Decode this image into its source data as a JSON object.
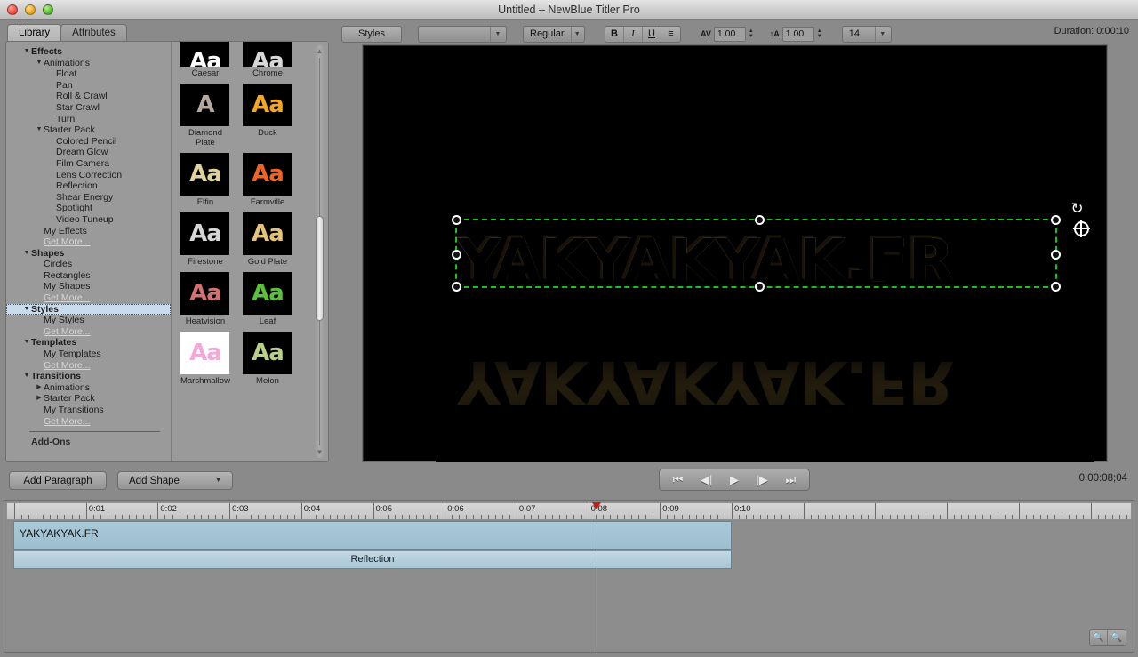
{
  "window": {
    "title": "Untitled – NewBlue Titler Pro",
    "traffic_lights": [
      "close-button",
      "minimize-button",
      "zoom-button"
    ]
  },
  "tabs": [
    {
      "label": "Library",
      "active": true
    },
    {
      "label": "Attributes",
      "active": false
    }
  ],
  "tree": [
    {
      "label": "Effects",
      "level": 0,
      "arrow": "▼"
    },
    {
      "label": "Animations",
      "level": 1,
      "arrow": "▼"
    },
    {
      "label": "Float",
      "level": 2,
      "arrow": ""
    },
    {
      "label": "Pan",
      "level": 2,
      "arrow": ""
    },
    {
      "label": "Roll & Crawl",
      "level": 2,
      "arrow": ""
    },
    {
      "label": "Star Crawl",
      "level": 2,
      "arrow": ""
    },
    {
      "label": "Turn",
      "level": 2,
      "arrow": ""
    },
    {
      "label": "Starter Pack",
      "level": 1,
      "arrow": "▼"
    },
    {
      "label": "Colored Pencil",
      "level": 2,
      "arrow": ""
    },
    {
      "label": "Dream Glow",
      "level": 2,
      "arrow": ""
    },
    {
      "label": "Film Camera",
      "level": 2,
      "arrow": ""
    },
    {
      "label": "Lens Correction",
      "level": 2,
      "arrow": ""
    },
    {
      "label": "Reflection",
      "level": 2,
      "arrow": ""
    },
    {
      "label": "Shear Energy",
      "level": 2,
      "arrow": ""
    },
    {
      "label": "Spotlight",
      "level": 2,
      "arrow": ""
    },
    {
      "label": "Video Tuneup",
      "level": 2,
      "arrow": ""
    },
    {
      "label": "My Effects",
      "level": 1,
      "arrow": ""
    },
    {
      "label": "Get More...",
      "level": 1,
      "arrow": "",
      "link": true
    },
    {
      "label": "Shapes",
      "level": 0,
      "arrow": "▼"
    },
    {
      "label": "Circles",
      "level": 1,
      "arrow": ""
    },
    {
      "label": "Rectangles",
      "level": 1,
      "arrow": ""
    },
    {
      "label": "My Shapes",
      "level": 1,
      "arrow": ""
    },
    {
      "label": "Get More...",
      "level": 1,
      "arrow": "",
      "link": true
    },
    {
      "label": "Styles",
      "level": 0,
      "arrow": "▼",
      "selected": true
    },
    {
      "label": "My Styles",
      "level": 1,
      "arrow": ""
    },
    {
      "label": "Get More...",
      "level": 1,
      "arrow": "",
      "link": true
    },
    {
      "label": "Templates",
      "level": 0,
      "arrow": "▼"
    },
    {
      "label": "My Templates",
      "level": 1,
      "arrow": ""
    },
    {
      "label": "Get More...",
      "level": 1,
      "arrow": "",
      "link": true
    },
    {
      "label": "Transitions",
      "level": 0,
      "arrow": "▼"
    },
    {
      "label": "Animations",
      "level": 1,
      "arrow": "▶"
    },
    {
      "label": "Starter Pack",
      "level": 1,
      "arrow": "▶"
    },
    {
      "label": "My Transitions",
      "level": 1,
      "arrow": ""
    },
    {
      "label": "Get More...",
      "level": 1,
      "arrow": "",
      "link": true
    }
  ],
  "tree_footer": {
    "label": "Add-Ons"
  },
  "style_thumbnails": [
    {
      "name": "Caesar",
      "glyph": "Aa",
      "fg": "#ffffff",
      "bg": "#000000",
      "partial": true
    },
    {
      "name": "Chrome",
      "glyph": "Aa",
      "fg": "#d8d8d8",
      "bg": "#000000",
      "partial": true
    },
    {
      "name": "Diamond Plate",
      "glyph": "A",
      "fg": "#b6a89c",
      "bg": "#000000"
    },
    {
      "name": "Duck",
      "glyph": "Aa",
      "fg": "#f5a623",
      "bg": "#000000"
    },
    {
      "name": "Elfin",
      "glyph": "Aa",
      "fg": "#ded39a",
      "bg": "#000000"
    },
    {
      "name": "Farmville",
      "glyph": "Aa",
      "fg": "#f06321",
      "bg": "#000000"
    },
    {
      "name": "Firestone",
      "glyph": "Aa",
      "fg": "#d6d6d6",
      "bg": "#000000"
    },
    {
      "name": "Gold Plate",
      "glyph": "Aa",
      "fg": "#e3c377",
      "bg": "#000000"
    },
    {
      "name": "Heatvision",
      "glyph": "Aa",
      "fg": "#d4706f",
      "bg": "#000000"
    },
    {
      "name": "Leaf",
      "glyph": "Aa",
      "fg": "#58c238",
      "bg": "#000000"
    },
    {
      "name": "Marshmallow",
      "glyph": "Aa",
      "fg": "#f3a8d8",
      "bg": "#ffffff"
    },
    {
      "name": "Melon",
      "glyph": "Aa",
      "fg": "#b9cf8a",
      "bg": "#000000"
    }
  ],
  "toolbar": {
    "styles_button": "Styles",
    "font_family_value": "",
    "font_style_value": "Regular",
    "bold_label": "B",
    "italic_label": "I",
    "underline_label": "U",
    "align_icon": "≡",
    "kerning_glyph": "AV",
    "kerning_value": "1.00",
    "leading_glyph": "↕A",
    "leading_value": "1.00",
    "font_size_value": "14",
    "duration_label": "Duration: 0:00:10"
  },
  "preview": {
    "title_text": "YAKYAKYAK.FR",
    "text_color": "#e8ce84",
    "selection_color": "#19c219",
    "background": "#000000"
  },
  "actions": {
    "add_paragraph": "Add Paragraph",
    "add_shape": "Add Shape"
  },
  "transport": {
    "buttons": [
      "skip-to-start",
      "step-back",
      "play",
      "step-forward",
      "skip-to-end"
    ],
    "glyphs": [
      "⏮",
      "◀|",
      "▶",
      "|▶",
      "⏭"
    ],
    "current_timecode": "0:00:08;04"
  },
  "timeline": {
    "ruler_labels": [
      "0:01",
      "0:02",
      "0:03",
      "0:04",
      "0:05",
      "0:06",
      "0:07",
      "0:08",
      "0:09",
      "0:10"
    ],
    "clip_name": "YAKYAKYAK.FR",
    "effect_name": "Reflection",
    "playhead_position": "0:08",
    "zoom_out_icon": "zoom-out-icon",
    "zoom_in_icon": "zoom-in-icon",
    "clip_color": "#9cbfd0"
  }
}
